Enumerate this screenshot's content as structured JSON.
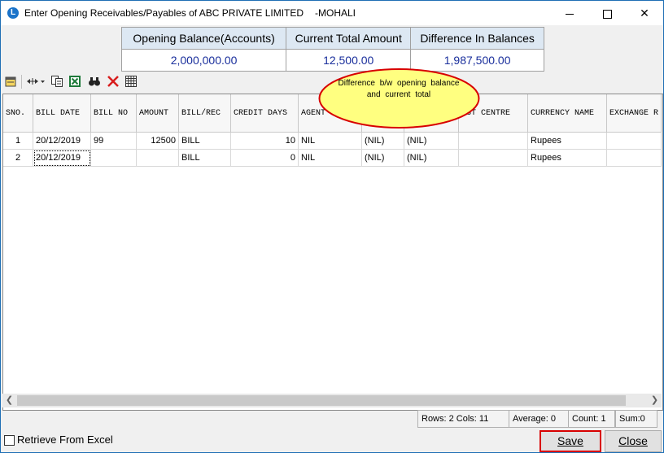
{
  "window": {
    "title": "Enter Opening Receivables/Payables of ABC PRIVATE LIMITED",
    "title_suffix": "-MOHALI"
  },
  "summary": {
    "headers": [
      "Opening Balance(Accounts)",
      "Current Total Amount",
      "Difference In Balances"
    ],
    "values": [
      "2,000,000.00",
      "12,500.00",
      "1,987,500.00"
    ]
  },
  "toolbar": {
    "icons": [
      "notes-icon",
      "resize-columns-icon",
      "copy-icon",
      "excel-icon",
      "find-icon",
      "delete-icon",
      "grid-icon"
    ]
  },
  "callout": {
    "text": "Difference b/w opening balance and current total"
  },
  "grid": {
    "columns": [
      "SNO.",
      "BILL DATE",
      "BILL NO",
      "AMOUNT",
      "BILL/REC",
      "CREDIT DAYS",
      "AGENT",
      "",
      "",
      "UST CENTRE",
      "CURRENCY NAME",
      "EXCHANGE R"
    ],
    "rows": [
      [
        "1",
        "20/12/2019",
        "99",
        "12500",
        "BILL",
        "10",
        "NIL",
        "(NIL)",
        "(NIL)",
        "",
        "Rupees",
        ""
      ],
      [
        "2",
        "20/12/2019",
        "",
        "",
        "BILL",
        "0",
        "NIL",
        "(NIL)",
        "(NIL)",
        "",
        "Rupees",
        ""
      ]
    ]
  },
  "statusbar": {
    "rows_cols": "Rows: 2  Cols: 11",
    "average": "Average: 0",
    "count": "Count: 1",
    "sum": "Sum:0"
  },
  "footer": {
    "retrieve_label": "Retrieve From Excel",
    "retrieve_checked": false,
    "save_label": "Save",
    "close_label": "Close"
  },
  "colors": {
    "value_text": "#1a2f9c",
    "header_fill": "#dde8f3",
    "callout_fill": "#ffff80",
    "callout_border": "#d80000",
    "save_highlight": "#d80000"
  }
}
